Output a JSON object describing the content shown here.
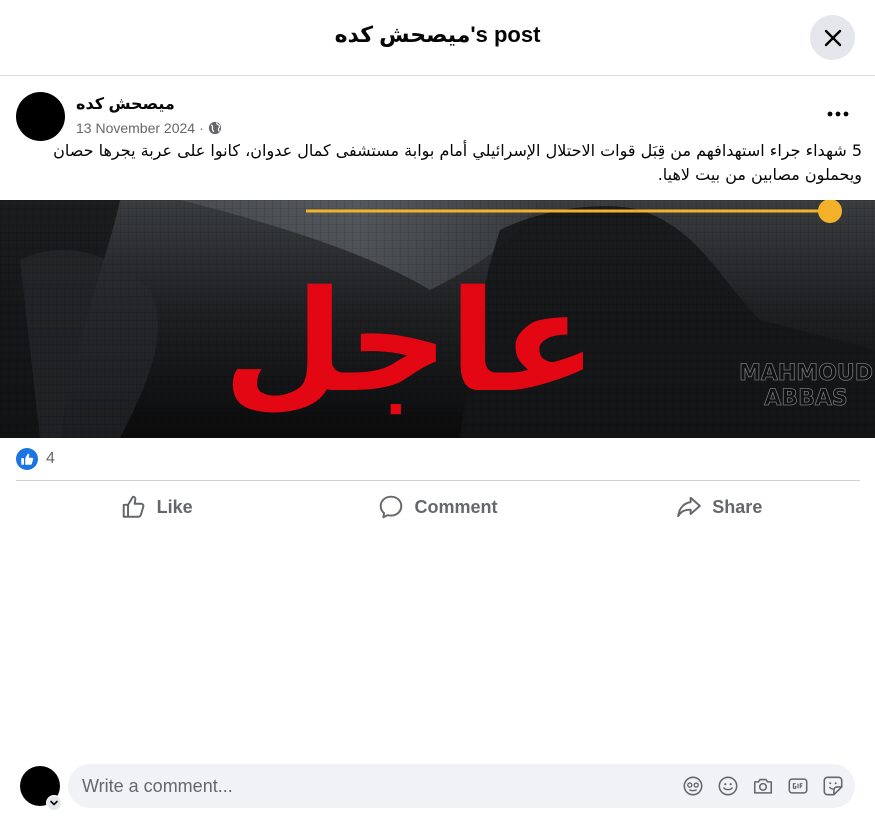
{
  "header": {
    "title": "ميصحش كده's post"
  },
  "post": {
    "author": "ميصحش كده",
    "date": "13 November 2024",
    "date_separator": "·",
    "text": "5 شهداء جراء استهدافهم من قِبَل قوات الاحتلال الإسرائيلي أمام بوابة مستشفى كمال عدوان، كانوا على عربة يجرها حصان ويحملون مصابين من بيت لاهيا.",
    "image": {
      "headline": "عاجل",
      "watermark_line1": "MAHMOUD",
      "watermark_line2": "ABBAS",
      "accent_color": "#e30613",
      "line_color": "#f4b22b"
    }
  },
  "reactions": {
    "count": "4",
    "icon": "like-icon",
    "color": "#1b74e4"
  },
  "actions": {
    "like": "Like",
    "comment": "Comment",
    "share": "Share"
  },
  "composer": {
    "placeholder": "Write a comment...",
    "tools": [
      "avatar-sticker-icon",
      "emoji-icon",
      "camera-icon",
      "gif-icon",
      "sticker-icon"
    ]
  }
}
